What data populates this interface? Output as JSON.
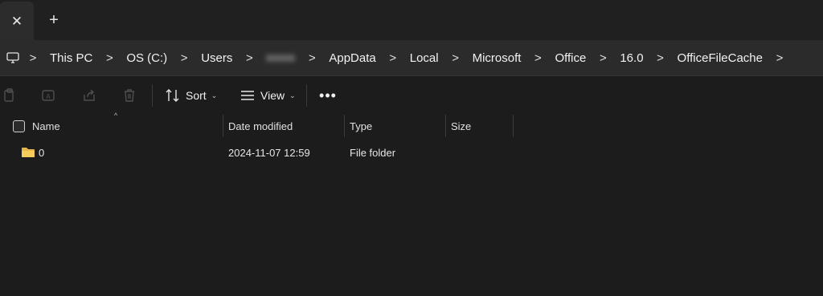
{
  "tabbar": {
    "close_icon": "close-icon",
    "close_glyph": "✕",
    "new_tab_glyph": "+"
  },
  "breadcrumb": {
    "items": [
      "This PC",
      "OS (C:)",
      "Users",
      "",
      "AppData",
      "Local",
      "Microsoft",
      "Office",
      "16.0",
      "OfficeFileCache"
    ],
    "separator": ">"
  },
  "toolbar": {
    "sort_label": "Sort",
    "view_label": "View",
    "more_label": "•••"
  },
  "columns": {
    "name": "Name",
    "date_modified": "Date modified",
    "type": "Type",
    "size": "Size"
  },
  "files": [
    {
      "name": "0",
      "date_modified": "2024-11-07 12:59",
      "type": "File folder",
      "size": ""
    }
  ],
  "colors": {
    "background": "#1c1c1c",
    "address_bar": "#2b2b2b",
    "folder": "#f4c430"
  }
}
